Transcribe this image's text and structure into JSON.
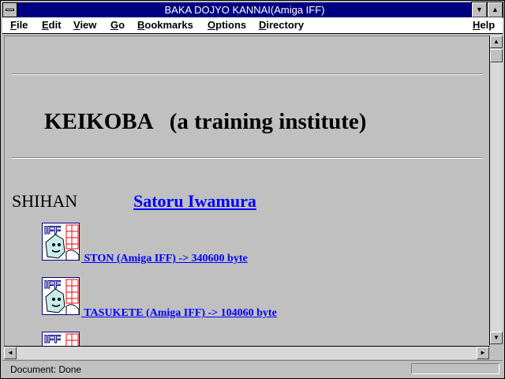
{
  "window": {
    "title": "BAKA DOJYO KANNAI(Amiga IFF)"
  },
  "menu": {
    "file": {
      "u": "F",
      "rest": "ile"
    },
    "edit": {
      "u": "E",
      "rest": "dit"
    },
    "view": {
      "u": "V",
      "rest": "iew"
    },
    "go": {
      "u": "G",
      "rest": "o"
    },
    "bookmarks": {
      "u": "B",
      "rest": "ookmarks"
    },
    "options": {
      "u": "O",
      "rest": "ptions"
    },
    "directory": {
      "u": "D",
      "rest": "irectory"
    },
    "help": {
      "u": "H",
      "rest": "elp"
    }
  },
  "page": {
    "heading": "KEIKOBA   (a training institute)",
    "shihan_label": "SHIHAN",
    "shihan_name": "Satoru Iwamura",
    "icon_text": "IFF",
    "files": [
      {
        "label": " STON (Amiga IFF) -> 340600 byte"
      },
      {
        "label": " TASUKETE (Amiga IFF) -> 104060 byte"
      }
    ]
  },
  "status": {
    "text": "Document: Done"
  }
}
